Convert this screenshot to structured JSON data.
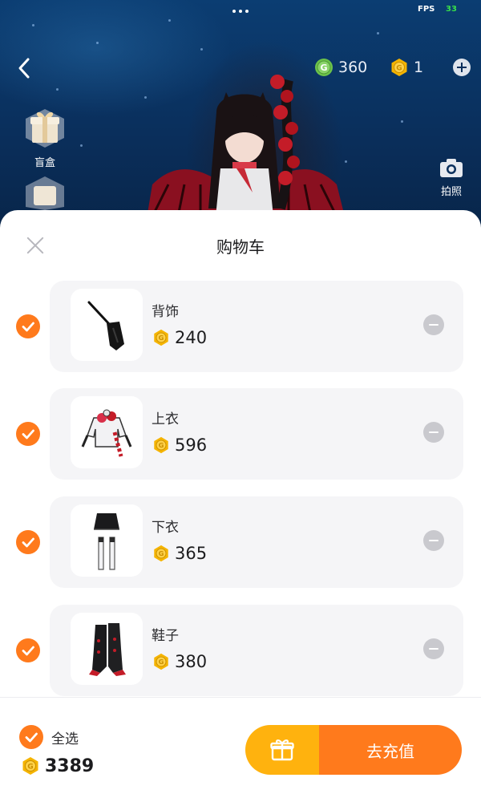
{
  "status": {
    "fps_label": "FPS",
    "fps_value": "33"
  },
  "topbar": {
    "green_coin_count": "360",
    "gold_coin_count": "1"
  },
  "side": {
    "blind_box_label": "盲盒",
    "photo_label": "拍照"
  },
  "cart": {
    "title": "购物车",
    "items": [
      {
        "name": "背饰",
        "price": "240",
        "checked": true,
        "icon": "back-accessory-icon"
      },
      {
        "name": "上衣",
        "price": "596",
        "checked": true,
        "icon": "top-clothing-icon"
      },
      {
        "name": "下衣",
        "price": "365",
        "checked": true,
        "icon": "bottom-clothing-icon"
      },
      {
        "name": "鞋子",
        "price": "380",
        "checked": true,
        "icon": "shoes-icon"
      }
    ]
  },
  "footer": {
    "select_all_label": "全选",
    "total": "3389",
    "recharge_label": "去充值"
  },
  "colors": {
    "accent_orange": "#ff7a1c",
    "gift_yellow": "#ffb20e",
    "coin_gold": "#f5b400",
    "coin_green": "#6cc24a"
  }
}
